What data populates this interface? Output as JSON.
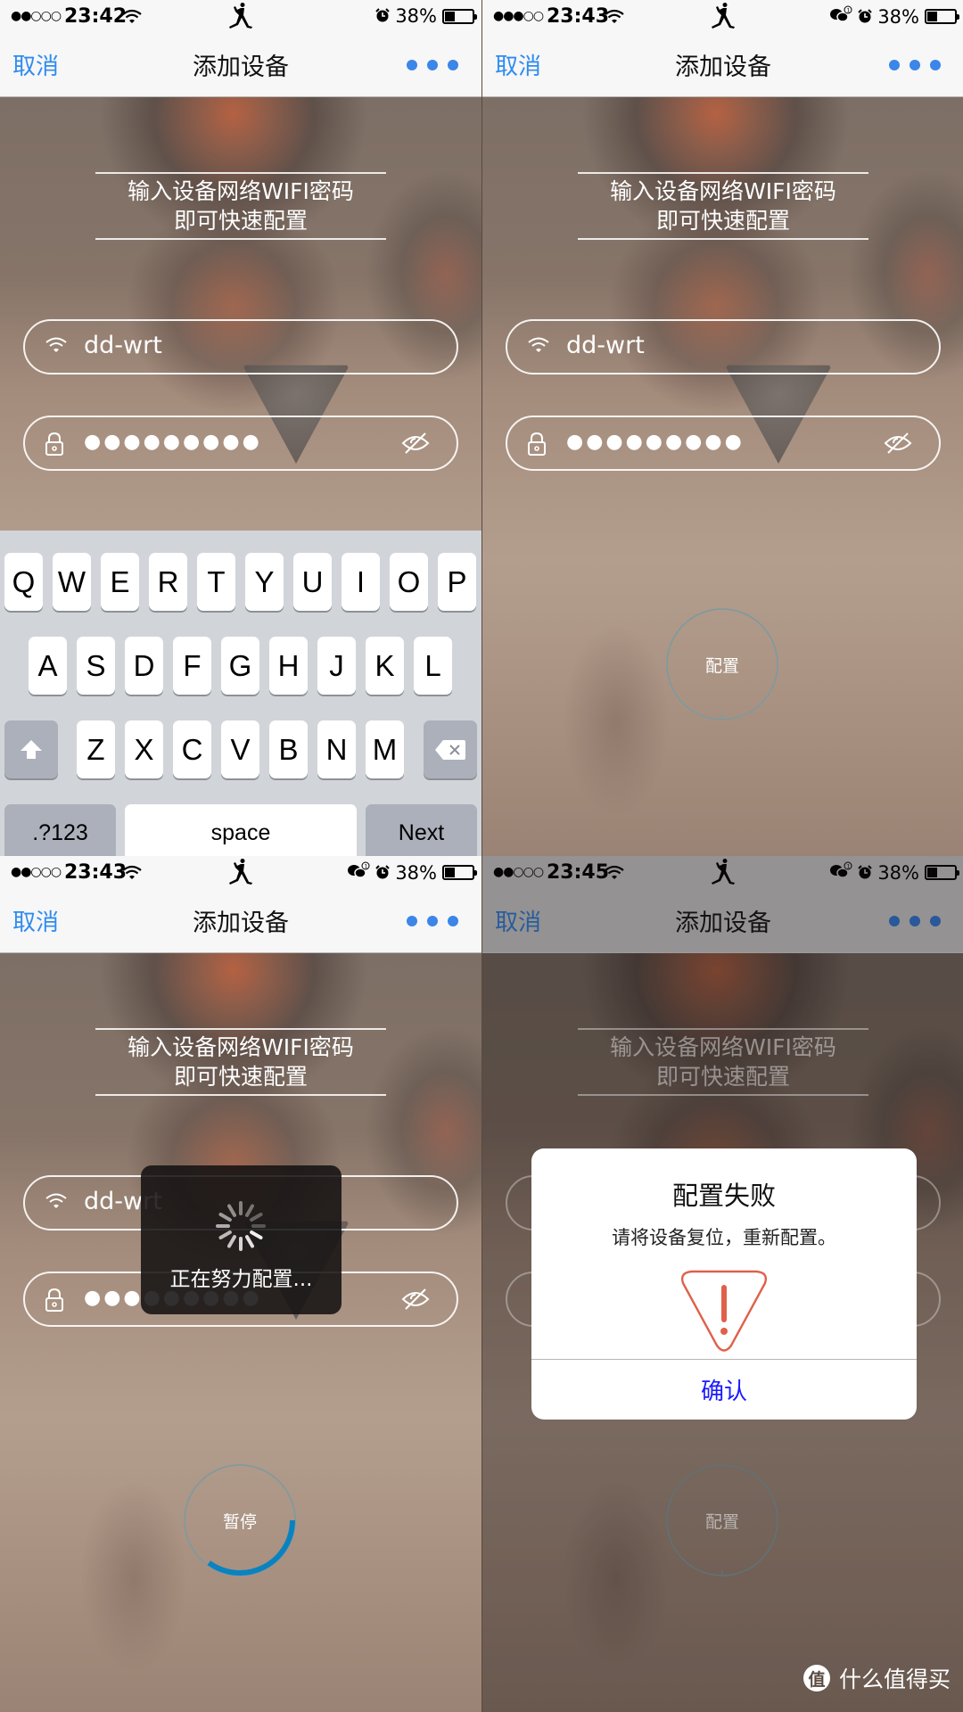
{
  "panels": [
    {
      "status": {
        "signal": "●●○○○",
        "time": "23:42",
        "battery_pct": "38%",
        "battery_level": 0.38,
        "wechat_notification": false
      },
      "nav": {
        "cancel": "取消",
        "title": "添加设备"
      },
      "intro": {
        "line1": "输入设备网络WIFI密码",
        "line2": "即可快速配置"
      },
      "ssid": "dd-wrt",
      "password_mask": "●●●●●●●●●",
      "keyboard": {
        "row1": [
          "Q",
          "W",
          "E",
          "R",
          "T",
          "Y",
          "U",
          "I",
          "O",
          "P"
        ],
        "row2": [
          "A",
          "S",
          "D",
          "F",
          "G",
          "H",
          "J",
          "K",
          "L"
        ],
        "row3": [
          "Z",
          "X",
          "C",
          "V",
          "B",
          "N",
          "M"
        ],
        "numbers": ".?123",
        "space": "space",
        "next": "Next"
      }
    },
    {
      "status": {
        "signal": "●●●○○",
        "time": "23:43",
        "battery_pct": "38%",
        "battery_level": 0.38,
        "wechat_notification": true,
        "wechat_badge": "①"
      },
      "nav": {
        "cancel": "取消",
        "title": "添加设备"
      },
      "intro": {
        "line1": "输入设备网络WIFI密码",
        "line2": "即可快速配置"
      },
      "ssid": "dd-wrt",
      "password_mask": "●●●●●●●●●",
      "action_button": "配置"
    },
    {
      "status": {
        "signal": "●●○○○",
        "time": "23:43",
        "battery_pct": "38%",
        "battery_level": 0.38,
        "wechat_notification": true,
        "wechat_badge": "①"
      },
      "nav": {
        "cancel": "取消",
        "title": "添加设备"
      },
      "intro": {
        "line1": "输入设备网络WIFI密码",
        "line2": "即可快速配置"
      },
      "ssid": "dd-wrt",
      "password_mask": "●●●●●●●●●",
      "hud_message": "正在努力配置...",
      "action_button": "暂停",
      "progress": 0.35
    },
    {
      "status": {
        "signal": "●●○○○",
        "time": "23:45",
        "battery_pct": "38%",
        "battery_level": 0.38,
        "wechat_notification": true,
        "wechat_badge": "①"
      },
      "nav": {
        "cancel": "取消",
        "title": "添加设备"
      },
      "intro": {
        "line1": "输入设备网络WIFI密码",
        "line2": "即可快速配置"
      },
      "action_button": "配置",
      "dialog": {
        "title": "配置失败",
        "message": "请将设备复位，重新配置。",
        "confirm": "确认"
      }
    }
  ],
  "colors": {
    "accent": "#2f8cf0",
    "progress": "#0a82c0",
    "warning": "#e0604a",
    "dialog_button": "#1a1aff"
  },
  "watermark": {
    "badge": "值",
    "text": "什么值得买"
  }
}
